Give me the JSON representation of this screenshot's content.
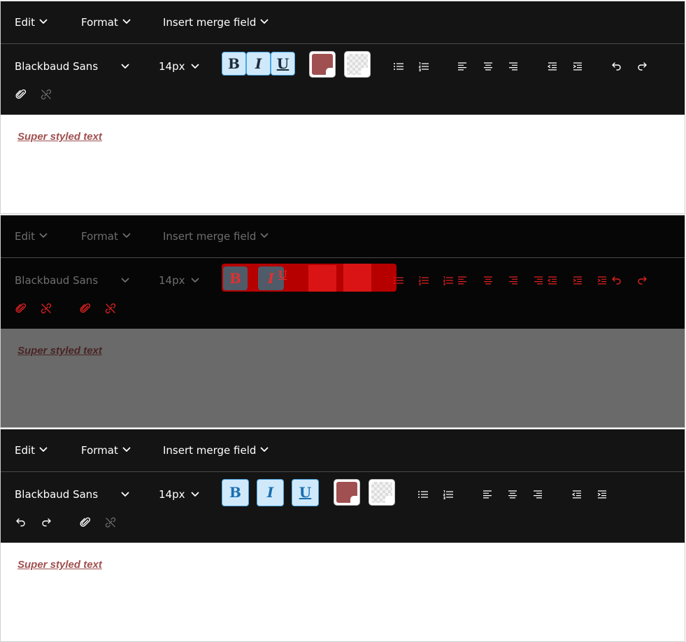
{
  "menu": {
    "edit": "Edit",
    "format": "Format",
    "insert_merge_field": "Insert merge field"
  },
  "toolbar": {
    "font_family": "Blackbaud Sans",
    "font_size": "14px",
    "bold": "B",
    "italic": "I",
    "underline": "U",
    "text_color": "#a05050",
    "highlight_color": "transparent"
  },
  "content": {
    "text": "Super styled text"
  },
  "icons": [
    "chevron-down-icon",
    "bulleted-list-icon",
    "numbered-list-icon",
    "align-left-icon",
    "align-center-icon",
    "align-right-icon",
    "outdent-icon",
    "indent-icon",
    "undo-icon",
    "redo-icon",
    "link-icon",
    "unlink-icon"
  ],
  "colors": {
    "toolbar_bg": "#141414",
    "disabled_toolbar_bg": "#060606",
    "button_bg": "#cfe9fb",
    "button_border": "#4aa6e1",
    "text_color": "#a05050",
    "debug_overlay": "#e01818"
  }
}
